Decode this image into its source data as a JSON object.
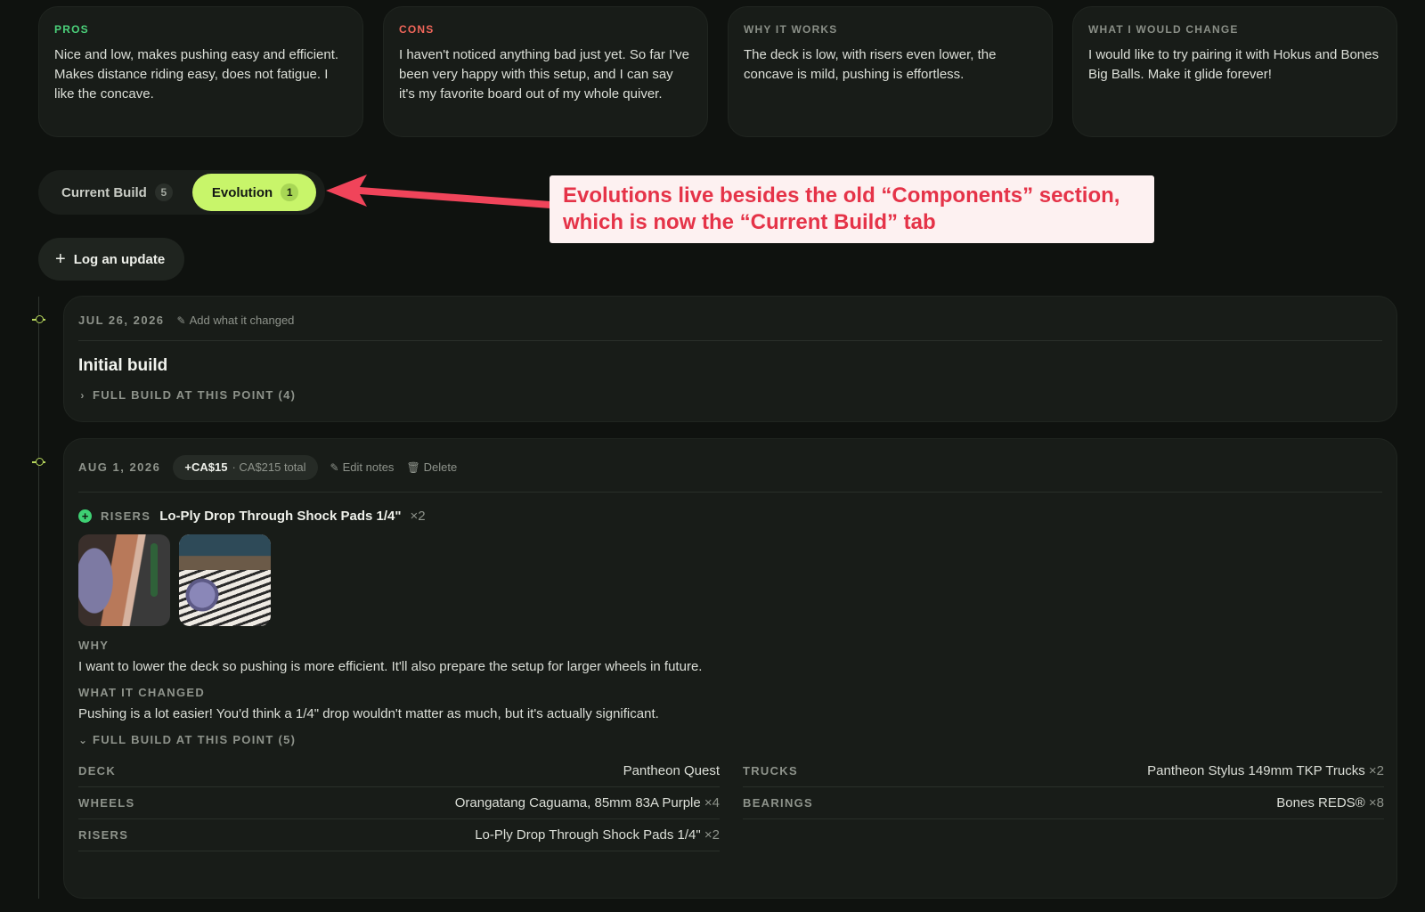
{
  "review_cards": [
    {
      "title": "PROS",
      "body": "Nice and low, makes pushing easy and efficient. Makes distance riding easy, does not fatigue. I like the concave."
    },
    {
      "title": "CONS",
      "body": "I haven't noticed anything bad just yet. So far I've been very happy with this setup, and I can say it's my favorite board out of my whole quiver."
    },
    {
      "title": "WHY IT WORKS",
      "body": "The deck is low, with risers even lower, the concave is mild, pushing is effortless."
    },
    {
      "title": "WHAT I WOULD CHANGE",
      "body": "I would like to try pairing it with Hokus and Bones Big Balls. Make it glide forever!"
    }
  ],
  "tabs": [
    {
      "label": "Current Build",
      "count": "5"
    },
    {
      "label": "Evolution",
      "count": "1"
    }
  ],
  "annotation": {
    "text": "Evolutions live besides the old “Components” section, which is now the “Current Build” tab",
    "color": "#e53348"
  },
  "log_button": {
    "label": "Log an update"
  },
  "entries": [
    {
      "date": "JUL 26, 2026",
      "add_changed_label": "Add what it changed",
      "title": "Initial build",
      "full_build_label": "FULL BUILD AT THIS POINT (4)"
    },
    {
      "date": "AUG 1, 2026",
      "cost_add": "+CA$15",
      "cost_total": "· CA$215 total",
      "edit_label": "Edit notes",
      "delete_label": "Delete",
      "change": {
        "category": "RISERS",
        "name": "Lo-Ply Drop Through Shock Pads 1/4\"",
        "qty": "×2"
      },
      "why_label": "WHY",
      "why_text": "I want to lower the deck so pushing is more efficient. It'll also prepare the setup for larger wheels in future.",
      "changed_label": "WHAT IT CHANGED",
      "changed_text": "Pushing is a lot easier! You'd think a 1/4\" drop wouldn't matter as much, but it's actually significant.",
      "full_build_label": "FULL BUILD AT THIS POINT (5)",
      "build": [
        {
          "category": "DECK",
          "value": "Pantheon Quest",
          "qty": ""
        },
        {
          "category": "TRUCKS",
          "value": "Pantheon Stylus 149mm TKP Trucks",
          "qty": "×2"
        },
        {
          "category": "WHEELS",
          "value": "Orangatang Caguama, 85mm 83A Purple",
          "qty": "×4"
        },
        {
          "category": "BEARINGS",
          "value": "Bones REDS®",
          "qty": "×8"
        },
        {
          "category": "RISERS",
          "value": "Lo-Ply Drop Through Shock Pads 1/4\"",
          "qty": "×2"
        }
      ]
    }
  ],
  "colors": {
    "accent": "#c8f56a",
    "pros": "#4bd17a",
    "cons": "#f0665a",
    "add": "#3ed073"
  }
}
